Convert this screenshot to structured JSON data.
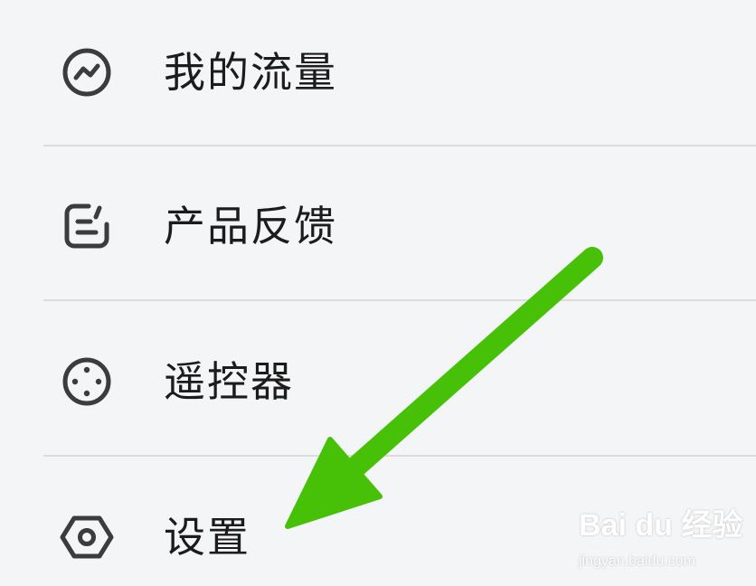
{
  "menu": {
    "items": [
      {
        "label": "我的流量",
        "icon": "traffic-chart-icon"
      },
      {
        "label": "产品反馈",
        "icon": "feedback-edit-icon"
      },
      {
        "label": "遥控器",
        "icon": "remote-control-icon"
      },
      {
        "label": "设置",
        "icon": "settings-hexagon-icon"
      }
    ]
  },
  "annotation": {
    "arrow_color": "#47c107",
    "arrow_target": "设置"
  },
  "watermark": {
    "logo_text": "Bai du 经验",
    "url": "jingyan.baidu.com"
  },
  "colors": {
    "background": "#f4f5f7",
    "text": "#1c1c1c",
    "icon": "#3c3c3c",
    "divider": "#dcdcdf"
  }
}
